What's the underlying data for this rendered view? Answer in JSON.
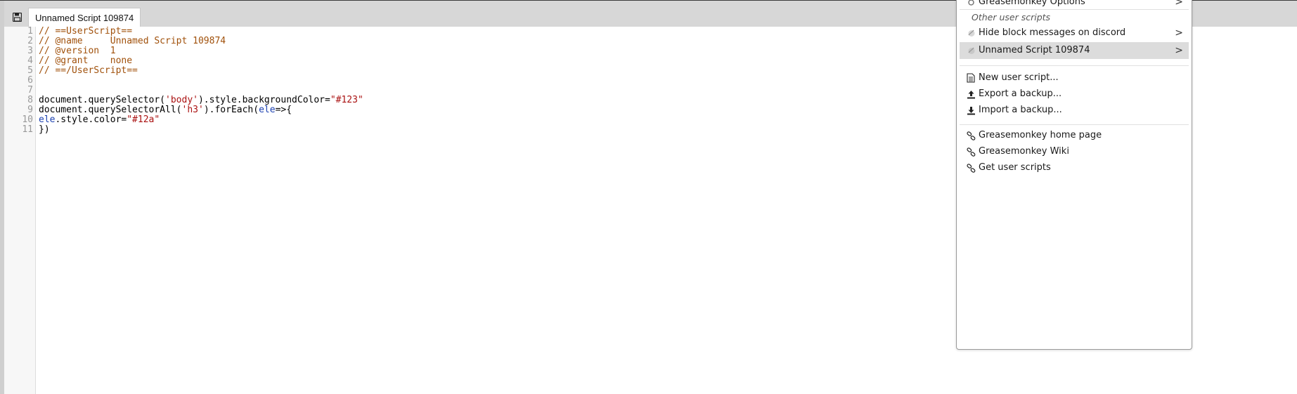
{
  "tab": {
    "title": "Unnamed Script 109874"
  },
  "toolbar": {
    "save_icon": "save-icon"
  },
  "editor": {
    "line_numbers": [
      "1",
      "2",
      "3",
      "4",
      "5",
      "6",
      "7",
      "8",
      "9",
      "10",
      "11"
    ],
    "lines": {
      "l1": "// ==UserScript==",
      "l2": "// @name     Unnamed Script 109874",
      "l3": "// @version  1",
      "l4": "// @grant    none",
      "l5": "// ==/UserScript==",
      "l8a": "document.querySelector(",
      "l8b": "'body'",
      "l8c": ").style.backgroundColor=",
      "l8d": "\"#123\"",
      "l9a": "document.querySelectorAll(",
      "l9b": "'h3'",
      "l9c": ").forEach(",
      "l9d": "ele",
      "l9e": "=>{",
      "l10a": "ele",
      "l10b": ".style.color=",
      "l10c": "\"#12a\"",
      "l11": "})"
    }
  },
  "menu": {
    "top_item": {
      "label": "Greasemonkey Options",
      "arrow": ">"
    },
    "section_heading": "Other user scripts",
    "scripts": [
      {
        "label": "Hide block messages on discord",
        "arrow": ">"
      },
      {
        "label": "Unnamed Script 109874",
        "arrow": ">"
      }
    ],
    "actions": [
      {
        "label": "New user script...",
        "icon": "new-document-icon"
      },
      {
        "label": "Export a backup...",
        "icon": "upload-icon"
      },
      {
        "label": "Import a backup...",
        "icon": "download-icon"
      }
    ],
    "links": [
      {
        "label": "Greasemonkey home page",
        "icon": "link-icon"
      },
      {
        "label": "Greasemonkey Wiki",
        "icon": "link-icon"
      },
      {
        "label": "Get user scripts",
        "icon": "link-icon"
      }
    ]
  },
  "colors": {
    "comment": "#a0500a",
    "string": "#aa1111",
    "variable": "#1a3fb0",
    "highlight": "#dcdcdc"
  }
}
